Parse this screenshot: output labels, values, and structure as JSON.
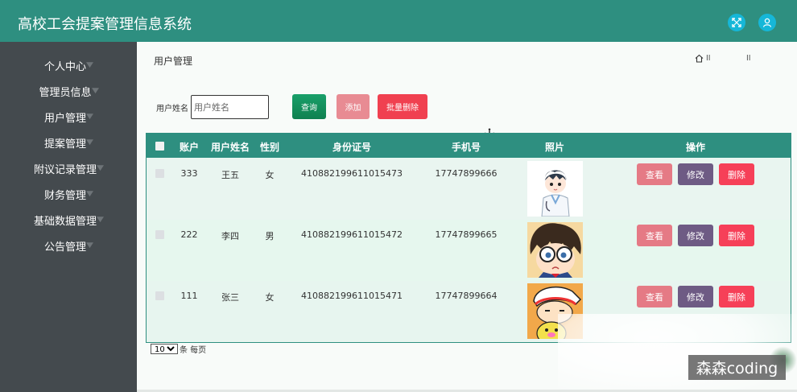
{
  "app": {
    "title": "高校工会提案管理信息系统"
  },
  "sidebar": {
    "items": [
      {
        "label": "个人中心"
      },
      {
        "label": "管理员信息"
      },
      {
        "label": "用户管理"
      },
      {
        "label": "提案管理"
      },
      {
        "label": "附议记录管理"
      },
      {
        "label": "财务管理"
      },
      {
        "label": "基础数据管理"
      },
      {
        "label": "公告管理"
      }
    ]
  },
  "breadcrumb": {
    "current": "用户管理",
    "right_sep": "II",
    "right_sep2": "II"
  },
  "search": {
    "label": "用户姓名",
    "placeholder": "用户姓名",
    "query_label": "查询",
    "add_label": "添加",
    "bulk_delete_label": "批量删除"
  },
  "table": {
    "headers": [
      "账户",
      "用户姓名",
      "性别",
      "身份证号",
      "手机号",
      "照片",
      "操作"
    ],
    "rows": [
      {
        "account": "333",
        "name": "王五",
        "gender": "女",
        "id_number": "410882199611015473",
        "phone": "17747899666"
      },
      {
        "account": "222",
        "name": "李四",
        "gender": "男",
        "id_number": "410882199611015472",
        "phone": "17747899665"
      },
      {
        "account": "111",
        "name": "张三",
        "gender": "女",
        "id_number": "410882199611015471",
        "phone": "17747899664"
      }
    ],
    "actions": {
      "view": "查看",
      "edit": "修改",
      "delete": "删除"
    }
  },
  "pager": {
    "page_size": "10",
    "per_page_label": "条 每页"
  },
  "watermark": "森森coding",
  "colors": {
    "header": "#2e8f80",
    "sidebar": "#444a4e",
    "query": "#14935e",
    "add": "#e88b93",
    "bulk_delete": "#f04050",
    "view": "#e57a85",
    "edit": "#6e5b84",
    "delete": "#f64058"
  },
  "icons": {
    "header_expand": "expand-icon",
    "header_user": "user-icon",
    "home": "home-icon"
  }
}
